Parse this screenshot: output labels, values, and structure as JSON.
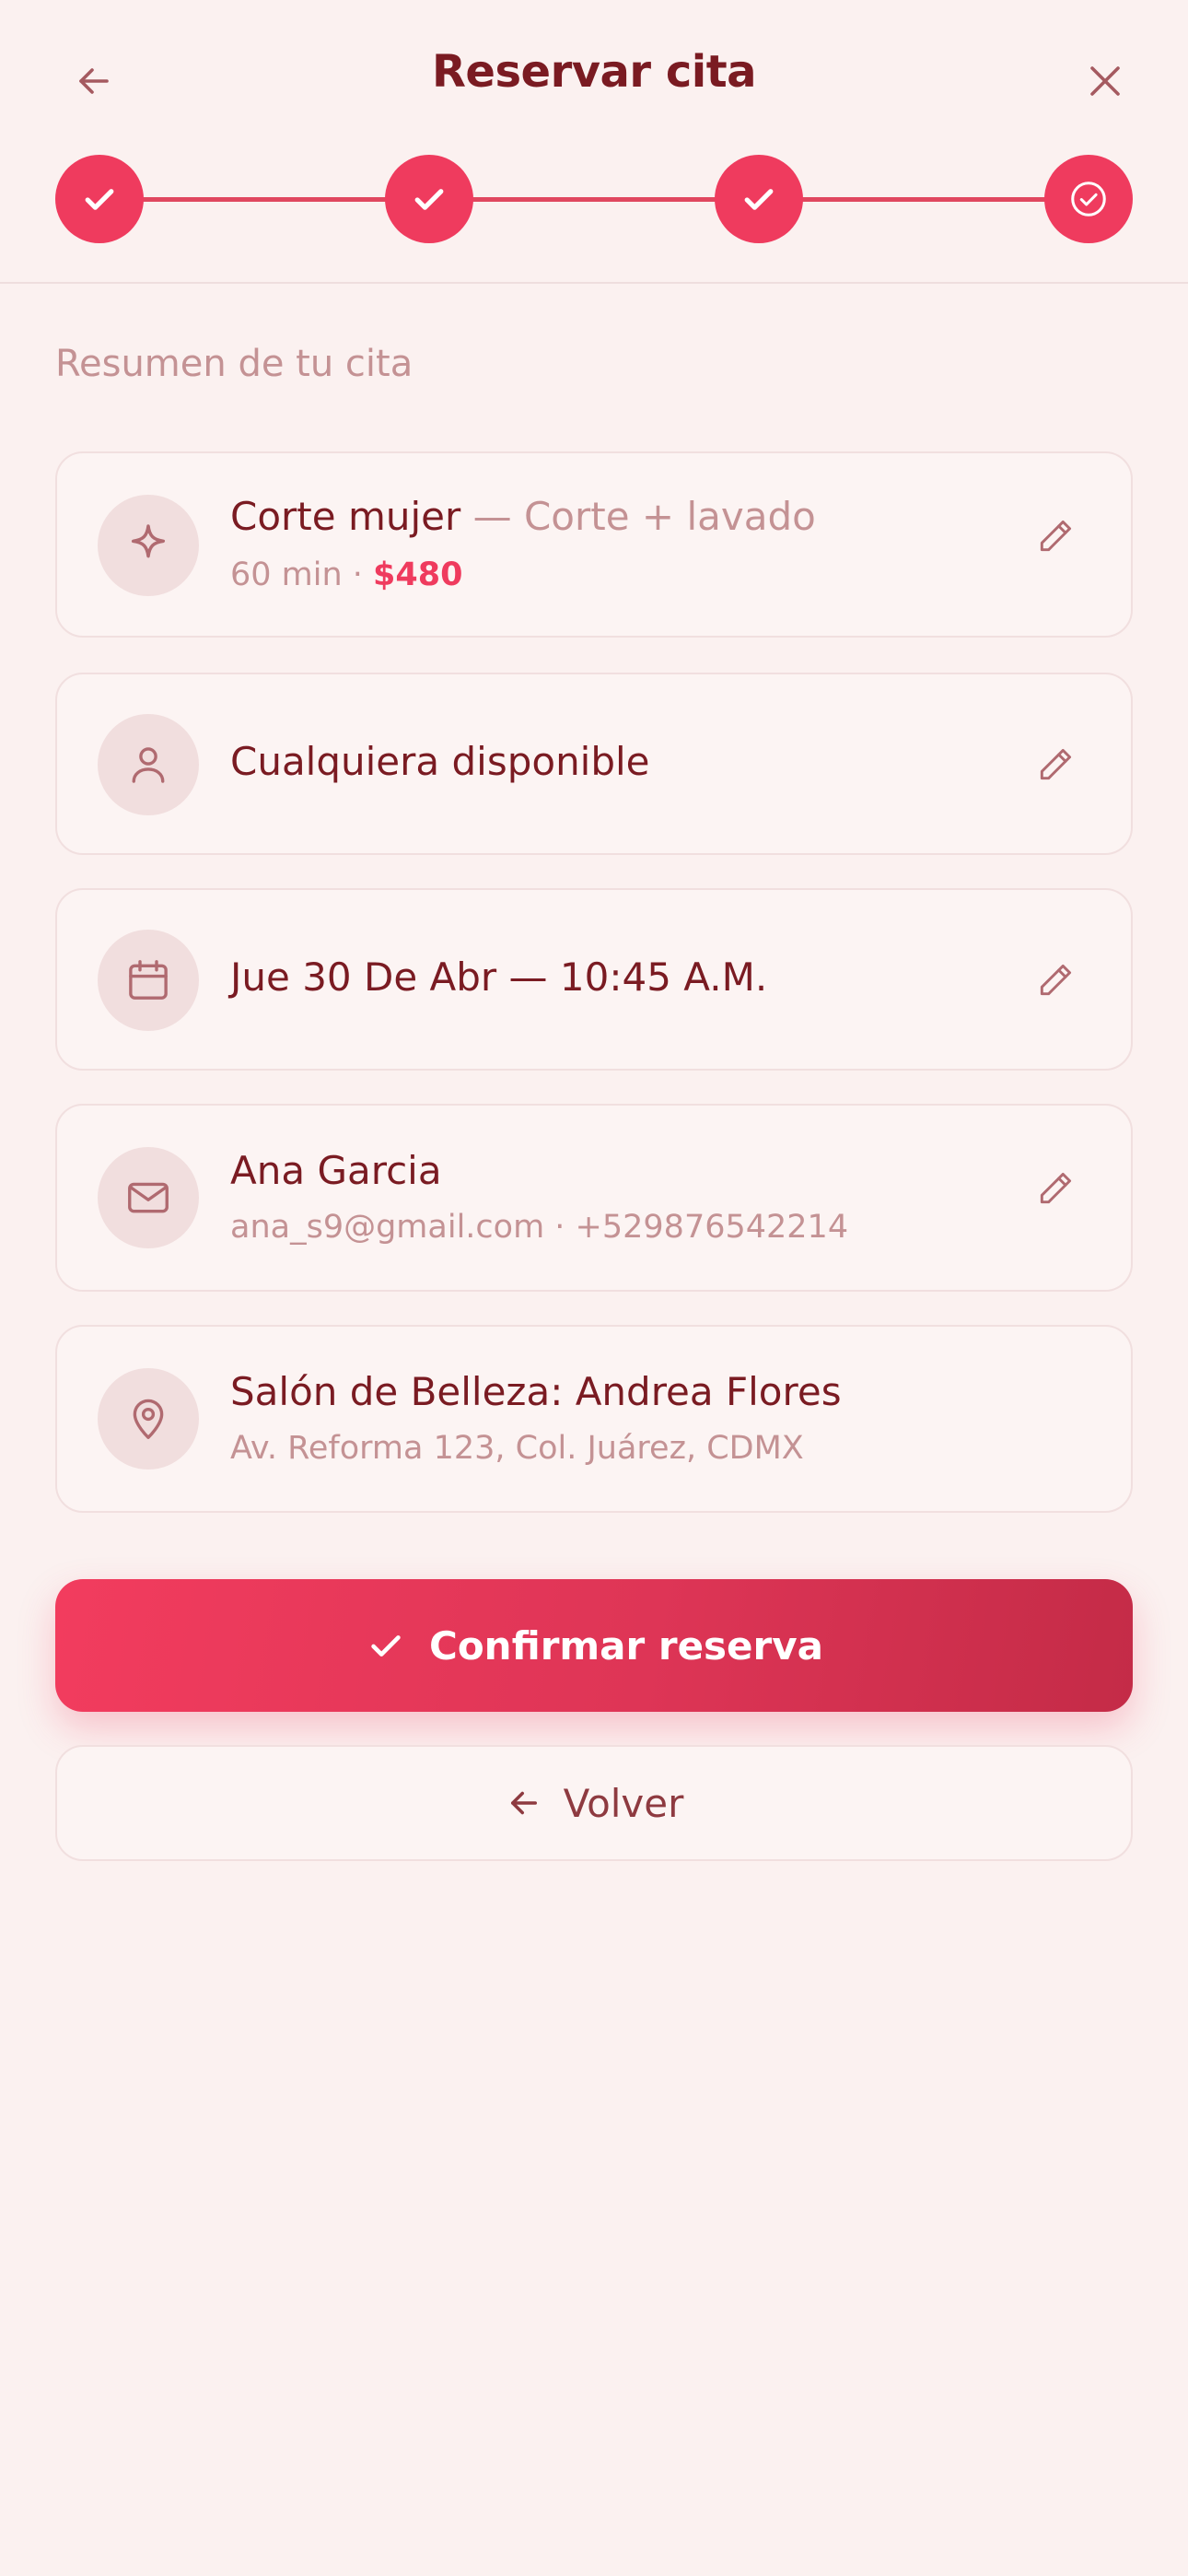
{
  "header": {
    "title": "Reservar cita",
    "back_icon": "arrow-left-icon",
    "close_icon": "close-icon"
  },
  "stepper": {
    "steps": [
      {
        "status": "completed",
        "icon": "check-icon"
      },
      {
        "status": "completed",
        "icon": "check-icon"
      },
      {
        "status": "completed",
        "icon": "check-icon"
      },
      {
        "status": "current",
        "icon": "check-circle-icon"
      }
    ],
    "accent_color": "#ef3b5e"
  },
  "summary": {
    "title": "Resumen de tu cita",
    "service": {
      "icon": "sparkle-icon",
      "name": "Corte mujer",
      "detail": " — Corte + lavado",
      "duration": "60 min · ",
      "price": "$480"
    },
    "staff": {
      "icon": "user-icon",
      "name": "Cualquiera disponible"
    },
    "datetime": {
      "icon": "calendar-icon",
      "value": "Jue 30 De Abr — 10:45 A.M."
    },
    "contact": {
      "icon": "mail-icon",
      "name": "Ana Garcia",
      "details": "ana_s9@gmail.com · +529876542214"
    },
    "location": {
      "icon": "map-pin-icon",
      "name": "Salón de Belleza: Andrea Flores",
      "address": "Av. Reforma 123, Col. Juárez, CDMX"
    },
    "edit_icon": "pencil-icon"
  },
  "actions": {
    "confirm_label": "Confirmar reserva",
    "confirm_icon": "check-icon",
    "back_label": "Volver",
    "back_icon": "arrow-left-icon"
  }
}
